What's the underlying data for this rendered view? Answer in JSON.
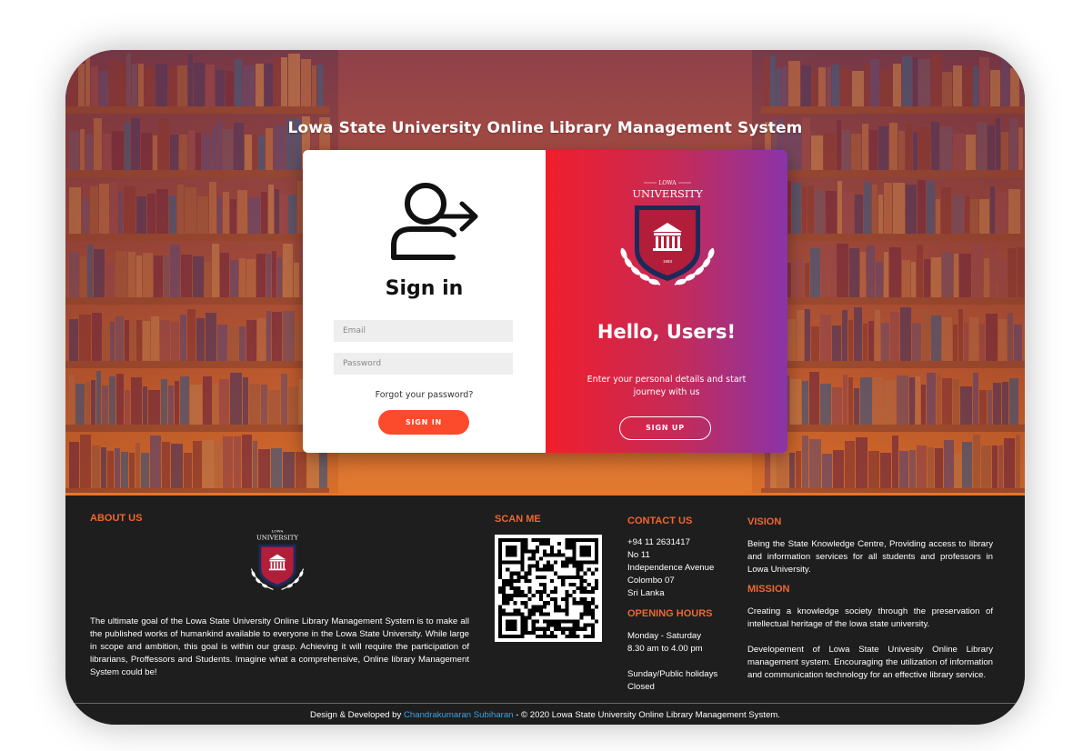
{
  "site_title": "Lowa State University Online Library Management System",
  "signin": {
    "title": "Sign in",
    "email_placeholder": "Email",
    "password_placeholder": "Password",
    "forgot": "Forgot your password?",
    "button": "SIGN IN"
  },
  "welcome": {
    "logo_top": "LOWA",
    "logo_name": "UNIVERSITY",
    "logo_year": "1983",
    "title": "Hello, Users!",
    "subtitle": "Enter your personal details and start journey with us",
    "button": "SIGN UP"
  },
  "footer": {
    "about": {
      "heading": "ABOUT US",
      "logo_top": "LOWA",
      "logo_name": "UNIVERSITY",
      "text": "The ultimate goal of the Lowa State University Online Library Management System is to make all the published works of humankind available to everyone in the Lowa State University. While large in scope and ambition, this goal is within our grasp. Achieving it will require the participation of librarians, Proffessors and Students. Imagine what a comprehensive, Online library Management System could be!"
    },
    "scan": {
      "heading": "SCAN ME"
    },
    "contact": {
      "heading": "CONTACT US",
      "lines": [
        "+94 11 2631417",
        "No 11",
        "Independence Avenue",
        "Colombo 07",
        "Sri Lanka"
      ]
    },
    "hours": {
      "heading": "OPENING HOURS",
      "weekday_days": "Monday - Saturday",
      "weekday_time": "8.30 am to 4.00 pm",
      "holiday_days": "Sunday/Public holidays",
      "holiday_status": "Closed"
    },
    "vision": {
      "heading": "VISION",
      "text": "Being the State Knowledge Centre, Providing access to library and information services for all students and professors in Lowa University."
    },
    "mission": {
      "heading": "MISSION",
      "text1": "Creating a knowledge society through the preservation of intellectual heritage of the lowa state university.",
      "text2": "Developement of Lowa State Univesity Online Library management system. Encouraging the utilization of information and communication technology for an effective library service."
    },
    "copyright": {
      "prefix": "Design & Developed by",
      "developer": "Chandrakumaran Subiharan",
      "suffix": "- © 2020 Lowa State University Online Library Management System."
    }
  },
  "colors": {
    "accent_orange": "#f0662e",
    "signin_button": "#fb4a2c",
    "gradient_start": "#f01e2c",
    "gradient_end": "#8a34a8",
    "footer_bg": "#1e1e1e",
    "link_blue": "#3aa3e6"
  },
  "icons": {
    "signin": "user-arrow-icon",
    "crest": "university-crest-icon",
    "qr": "qr-code-icon"
  }
}
